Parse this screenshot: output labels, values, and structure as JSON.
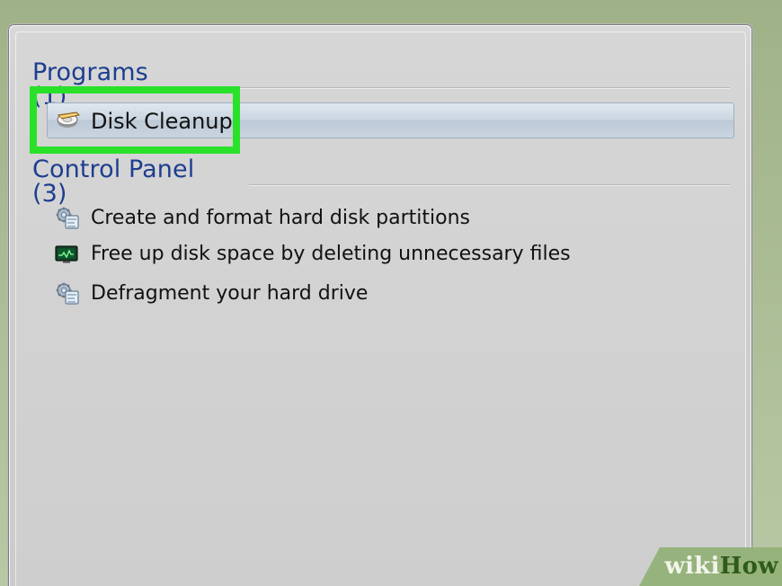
{
  "window": {
    "title": ""
  },
  "sections": {
    "programs": {
      "title": "Programs (1)",
      "items": [
        {
          "label": "Disk Cleanup",
          "icon": "disk-cleanup-icon"
        }
      ]
    },
    "control_panel": {
      "title": "Control Panel (3)",
      "items": [
        {
          "label": "Create and format hard disk partitions",
          "icon": "control-panel-tool-icon"
        },
        {
          "label": "Free up disk space by deleting unnecessary files",
          "icon": "system-monitor-icon"
        },
        {
          "label": "Defragment your hard drive",
          "icon": "control-panel-tool-icon"
        }
      ]
    }
  },
  "highlight": {
    "color": "#2ae12a"
  },
  "branding": {
    "wiki": "wiki",
    "how": "How"
  },
  "colors": {
    "panel": "#cfcfcf",
    "section_text": "#1d3d8f",
    "selection": "#c9d4df",
    "watermark_bg": "#95b27a"
  }
}
